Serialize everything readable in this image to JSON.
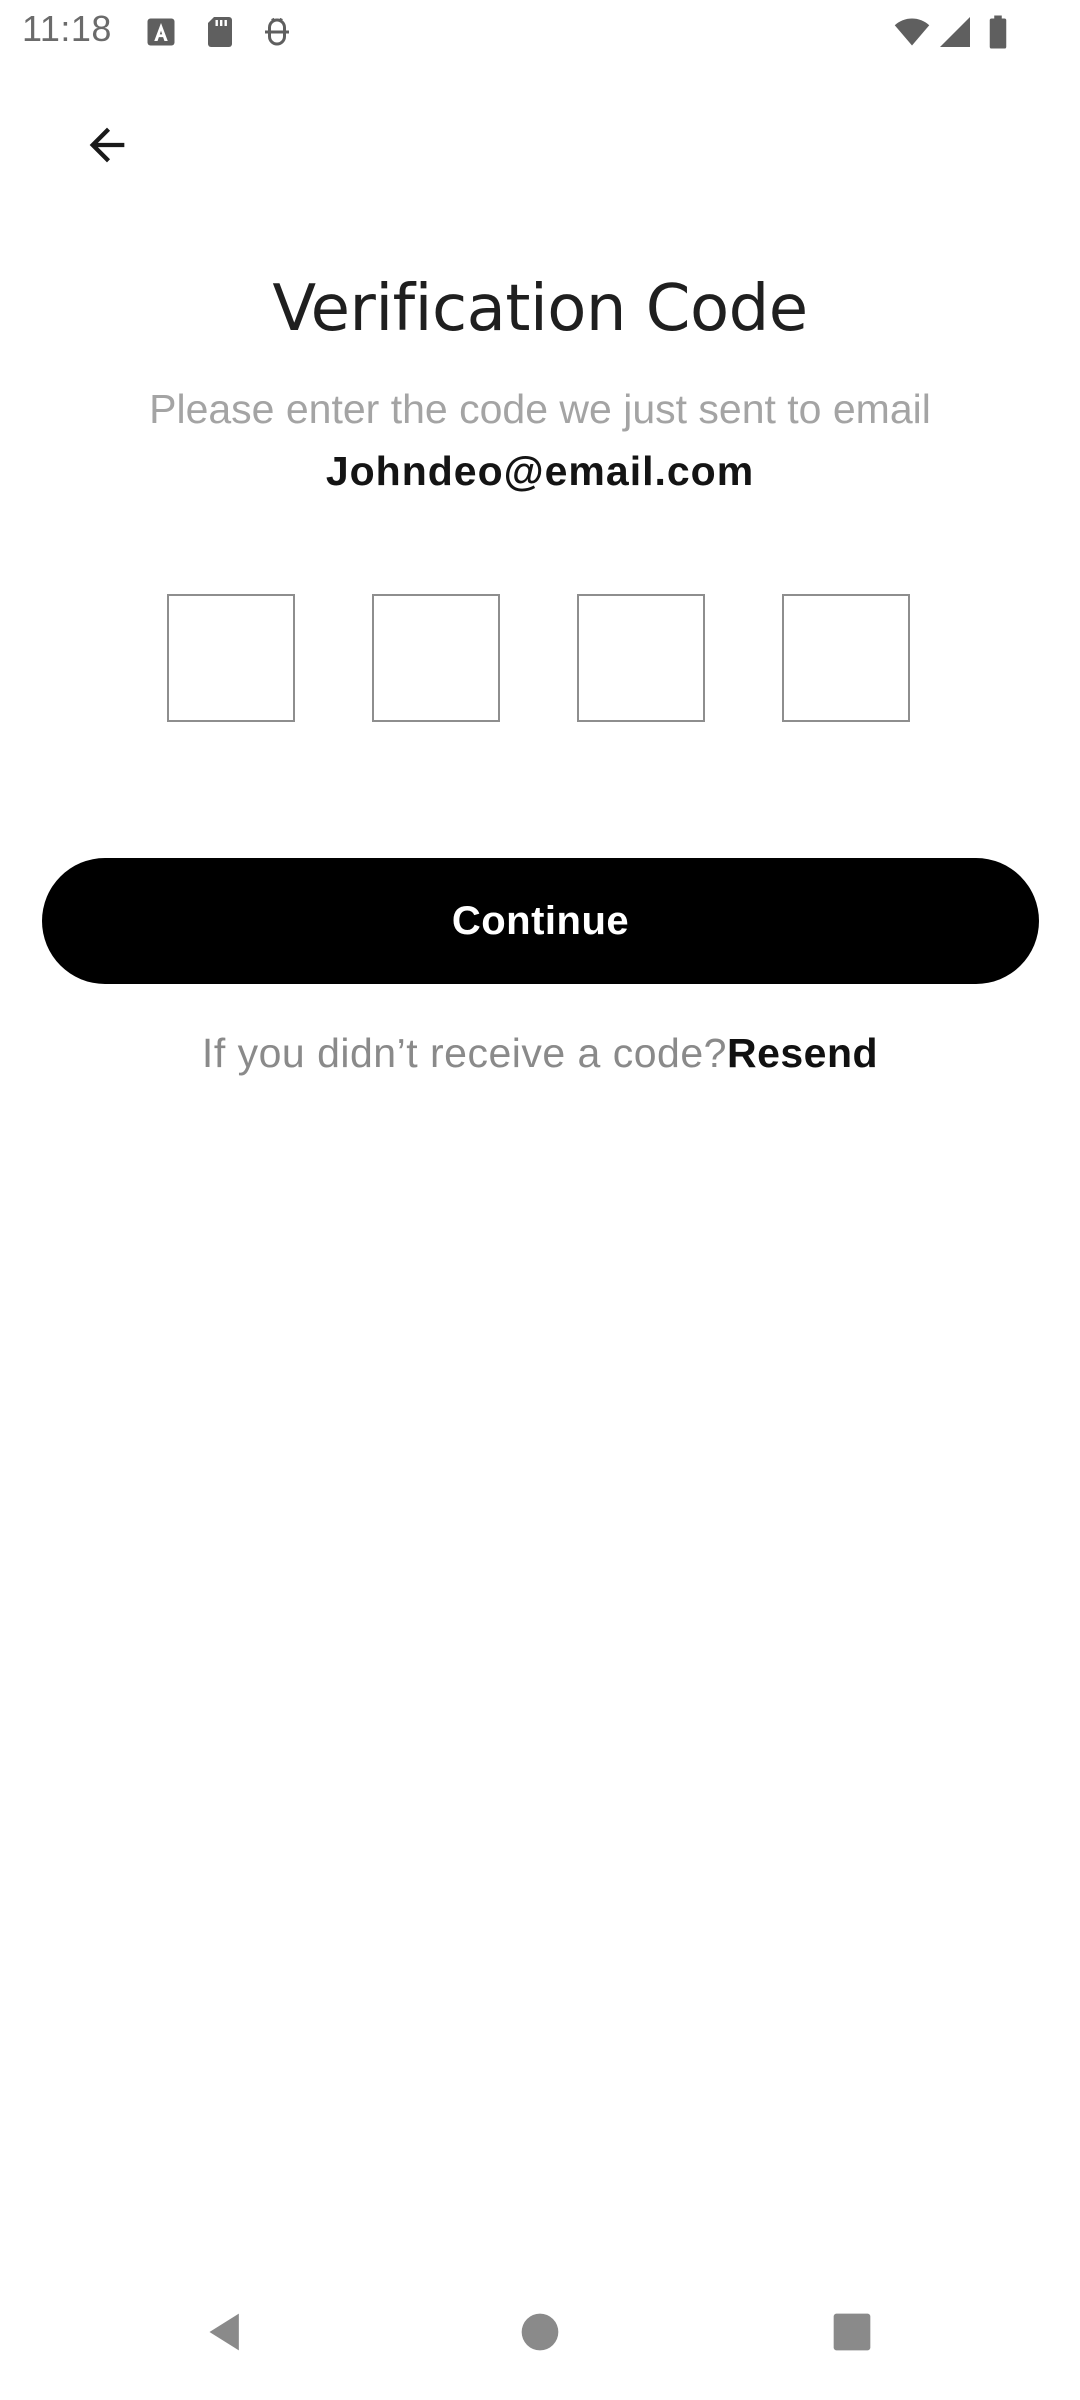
{
  "status_bar": {
    "time": "11:18",
    "icons": [
      "accessibility-a-icon",
      "sd-card-icon",
      "debug-icon",
      "wifi-icon",
      "signal-icon",
      "battery-icon"
    ]
  },
  "header": {
    "back_icon": "arrow-left-icon"
  },
  "content": {
    "title": "Verification Code",
    "subtitle": "Please enter the code we just sent to email",
    "email": "Johndeo@email.com",
    "code_digits": [
      "",
      "",
      "",
      ""
    ]
  },
  "actions": {
    "continue_label": "Continue",
    "resend_prompt": "If you didn’t receive a code?",
    "resend_label": "Resend"
  },
  "navigation": {
    "icons": [
      "back-triangle-icon",
      "home-circle-icon",
      "recents-square-icon"
    ]
  },
  "colors": {
    "primary_button": "#000000",
    "subtitle_text": "#a4a4a4",
    "code_box_border": "#8e8e8e",
    "nav_icons": "#8a8a8a"
  }
}
